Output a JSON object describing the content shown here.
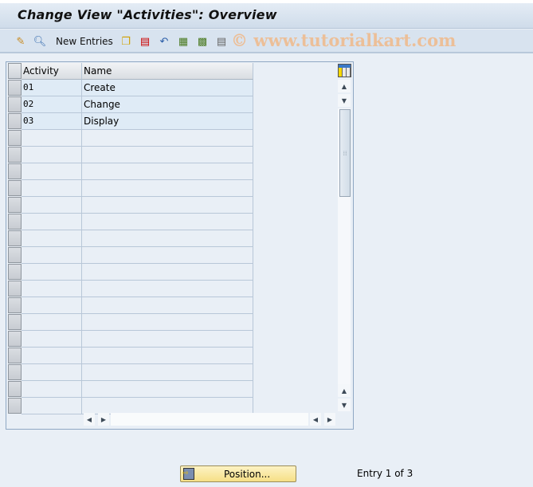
{
  "window": {
    "title": "Change View \"Activities\": Overview"
  },
  "toolbar": {
    "new_entries_label": "New Entries",
    "icons": [
      "change-display-icon",
      "details-icon",
      "copy-icon",
      "delete-icon",
      "undo-icon",
      "select-all-icon",
      "select-block-icon",
      "deselect-all-icon"
    ]
  },
  "watermark": "© www.tutorialkart.com",
  "table": {
    "columns": [
      "Activity",
      "Name"
    ],
    "rows": [
      {
        "activity": "01",
        "name": "Create"
      },
      {
        "activity": "02",
        "name": "Change"
      },
      {
        "activity": "03",
        "name": "Display"
      }
    ],
    "empty_rows": 17
  },
  "footer": {
    "position_label": "Position...",
    "entry_text": "Entry 1 of 3"
  }
}
